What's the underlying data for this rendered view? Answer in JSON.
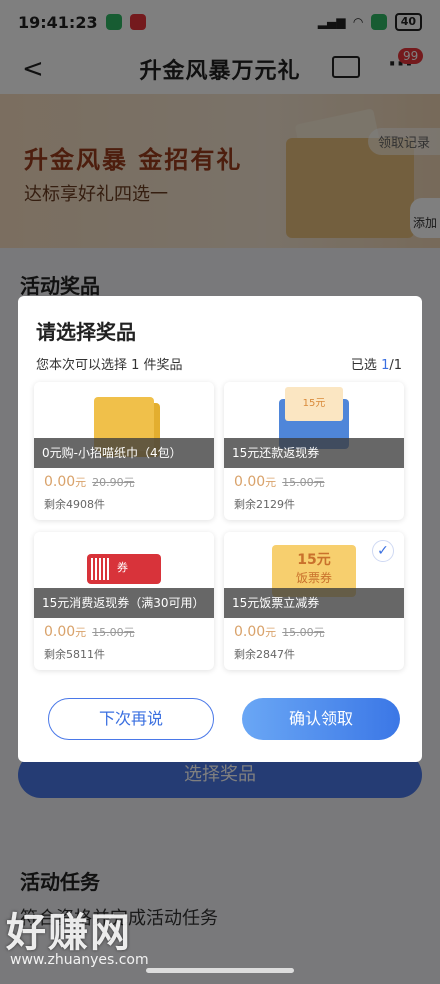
{
  "status": {
    "time": "19:41:23",
    "battery": "40"
  },
  "nav": {
    "back": "<",
    "title": "升金风暴万元礼",
    "more": "···",
    "badge": "99"
  },
  "banner": {
    "headline": "升金风暴 金招有礼",
    "subline": "达标享好礼四选一",
    "record": "领取记录",
    "add": "添加"
  },
  "page": {
    "section_prizes": "活动奖品",
    "select_prize_btn": "选择奖品",
    "section_tasks": "活动任务",
    "task_desc": "符合资格并完成活动任务"
  },
  "modal": {
    "title": "请选择奖品",
    "hint": "您本次可以选择 1 件奖品",
    "selected_label": "已选 ",
    "selected_num": "1",
    "selected_total": "/1",
    "cards": [
      {
        "name": "0元购-小招喵纸巾（4包）",
        "price": "0.00",
        "unit": "元",
        "orig": "20.90元",
        "remain": "剩余4908件"
      },
      {
        "name": "15元还款返现券",
        "price": "0.00",
        "unit": "元",
        "orig": "15.00元",
        "remain": "剩余2129件"
      },
      {
        "name": "15元消费返现券（满30可用）",
        "price": "0.00",
        "unit": "元",
        "orig": "15.00元",
        "remain": "剩余5811件"
      },
      {
        "name": "15元饭票立减券",
        "price": "0.00",
        "unit": "元",
        "orig": "15.00元",
        "remain": "剩余2847件"
      }
    ],
    "img_labels": {
      "coupon2": "15元",
      "coupon3": "券",
      "coupon4_a": "15元",
      "coupon4_b": "饭票券"
    },
    "btn_later": "下次再说",
    "btn_confirm": "确认领取"
  },
  "watermark": {
    "text": "好赚网",
    "url": "www.zhuanyes.com"
  }
}
